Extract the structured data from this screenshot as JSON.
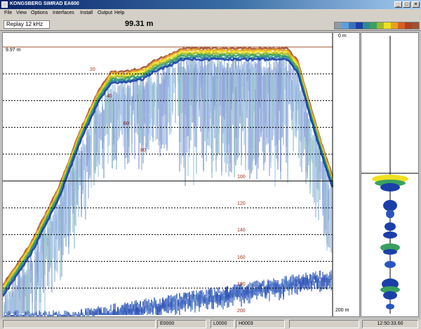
{
  "window": {
    "title": "KONGSBERG SIMRAD EA600"
  },
  "window_controls": [
    "_",
    "□",
    "✕"
  ],
  "menu": [
    "File",
    "View",
    "Options",
    "Interfaces",
    "Install",
    "Output",
    "Help"
  ],
  "toolbar": {
    "mode": "Replay 12 kHz",
    "depth": "99.31 m"
  },
  "palette": [
    "#8f9aa6",
    "#5aa0dc",
    "#3c6fbe",
    "#1a3fa8",
    "#2e8a92",
    "#3aa060",
    "#9cb830",
    "#f0e020",
    "#e8a020",
    "#d86020",
    "#b04020",
    "#a05030"
  ],
  "echogram": {
    "top_range_label": "0 m",
    "bottom_range_label": "200 m",
    "surface_label": "9.97 m",
    "depth_ticks": [
      "20",
      "40",
      "60",
      "80",
      "100",
      "120",
      "140",
      "160",
      "180",
      "200"
    ]
  },
  "statusbar": {
    "e_value": "E0000",
    "l_value": "L0000",
    "h_value": "H0003",
    "time": "12:50:33.60"
  }
}
